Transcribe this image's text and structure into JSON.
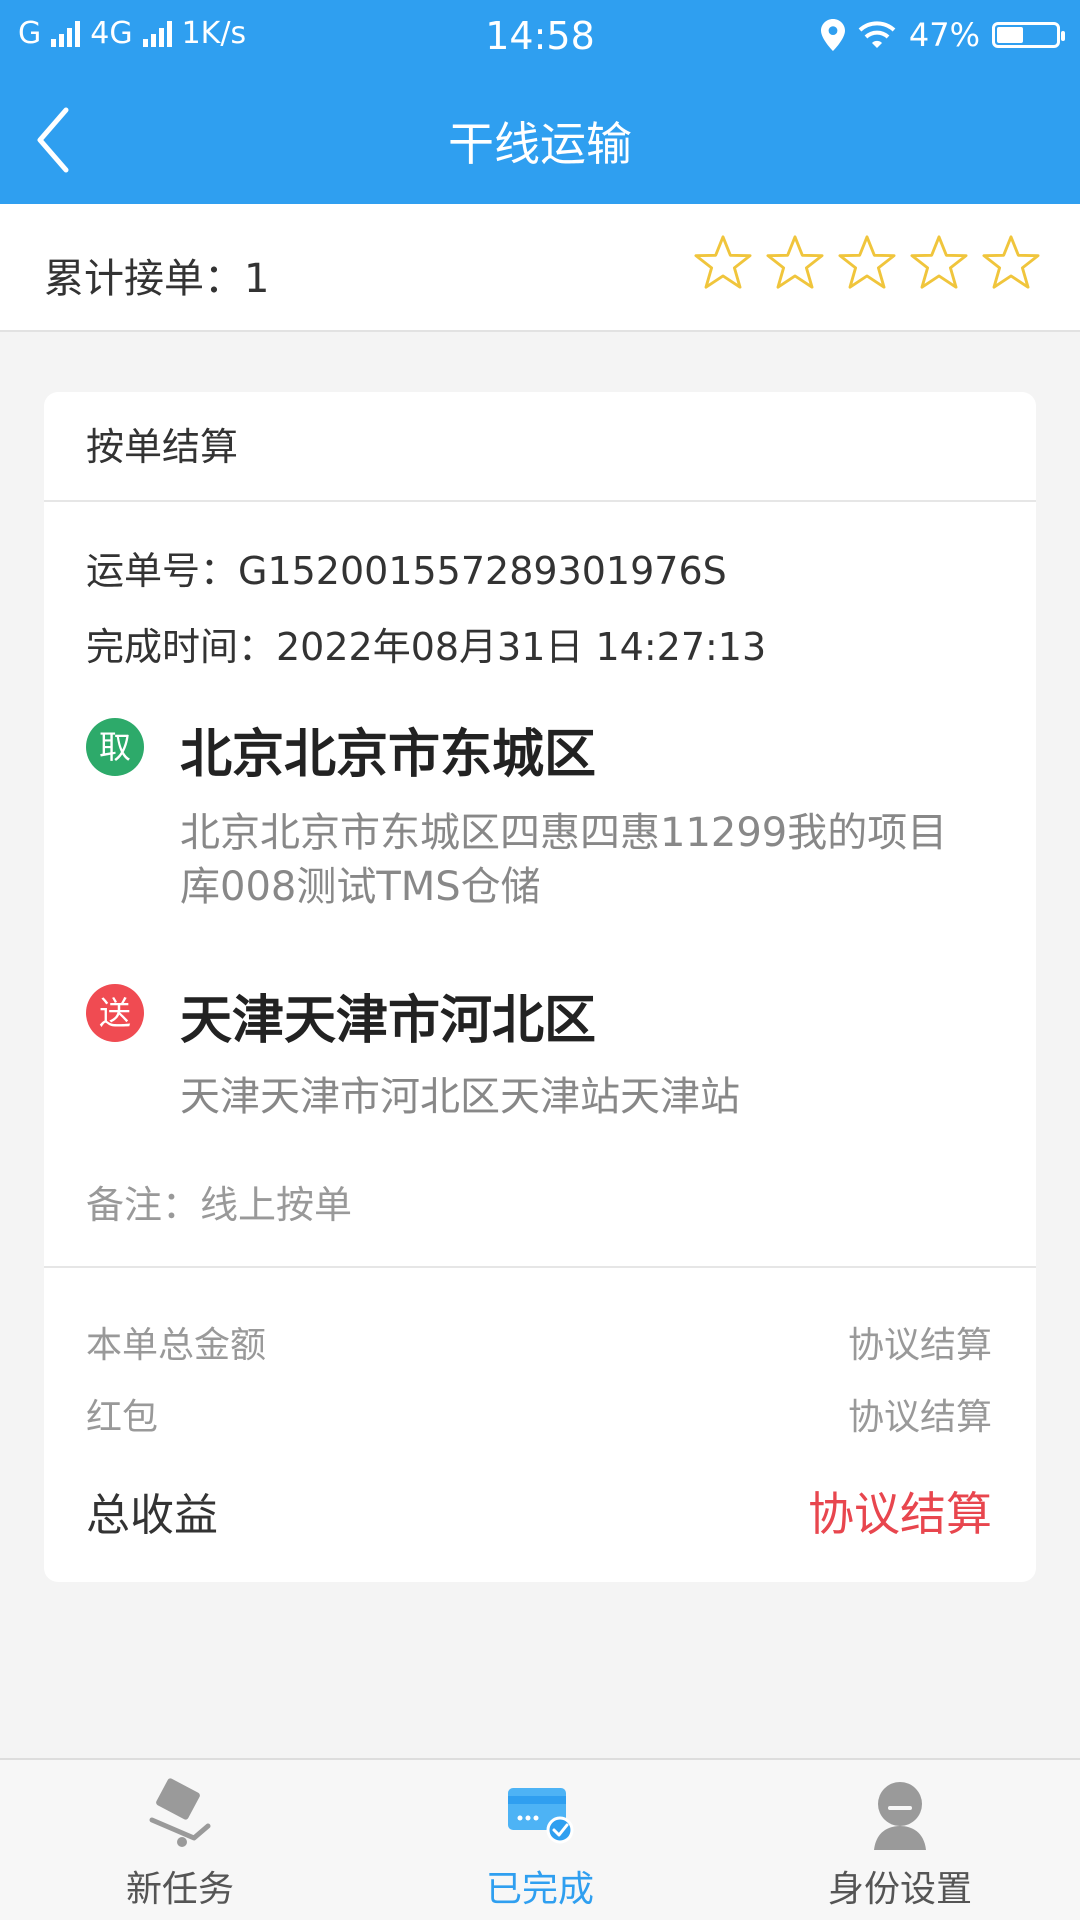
{
  "status_bar": {
    "carrier": "G",
    "network": "4G",
    "speed": "1K/s",
    "time": "14:58",
    "battery": "47%"
  },
  "header": {
    "title": "干线运输"
  },
  "summary": {
    "orders_label": "累计接单：1",
    "rating": {
      "filled": 0,
      "total": 5
    }
  },
  "order": {
    "section_title": "按单结算",
    "waybill": "运单号：G152001557289301976S",
    "complete_time": "完成时间：2022年08月31日 14:27:13",
    "pickup": {
      "badge": "取",
      "city": "北京北京市东城区",
      "address": "北京北京市东城区四惠四惠11299我的项目库008测试TMS仓储"
    },
    "delivery": {
      "badge": "送",
      "city": "天津天津市河北区",
      "address": "天津天津市河北区天津站天津站"
    },
    "remark": "备注：线上按单",
    "fees": [
      {
        "label": "本单总金额",
        "value": "协议结算"
      },
      {
        "label": "红包",
        "value": "协议结算"
      }
    ],
    "total": {
      "label": "总收益",
      "value": "协议结算"
    }
  },
  "bottom_nav": {
    "items": [
      {
        "label": "新任务",
        "icon": "cart-icon",
        "active": false
      },
      {
        "label": "已完成",
        "icon": "card-check-icon",
        "active": true
      },
      {
        "label": "身份设置",
        "icon": "user-icon",
        "active": false
      }
    ]
  },
  "colors": {
    "primary": "#2f9ff0",
    "pickup": "#2daa6a",
    "deliver": "#f04b52",
    "total": "#e8464e",
    "star": "#f0c53c"
  }
}
